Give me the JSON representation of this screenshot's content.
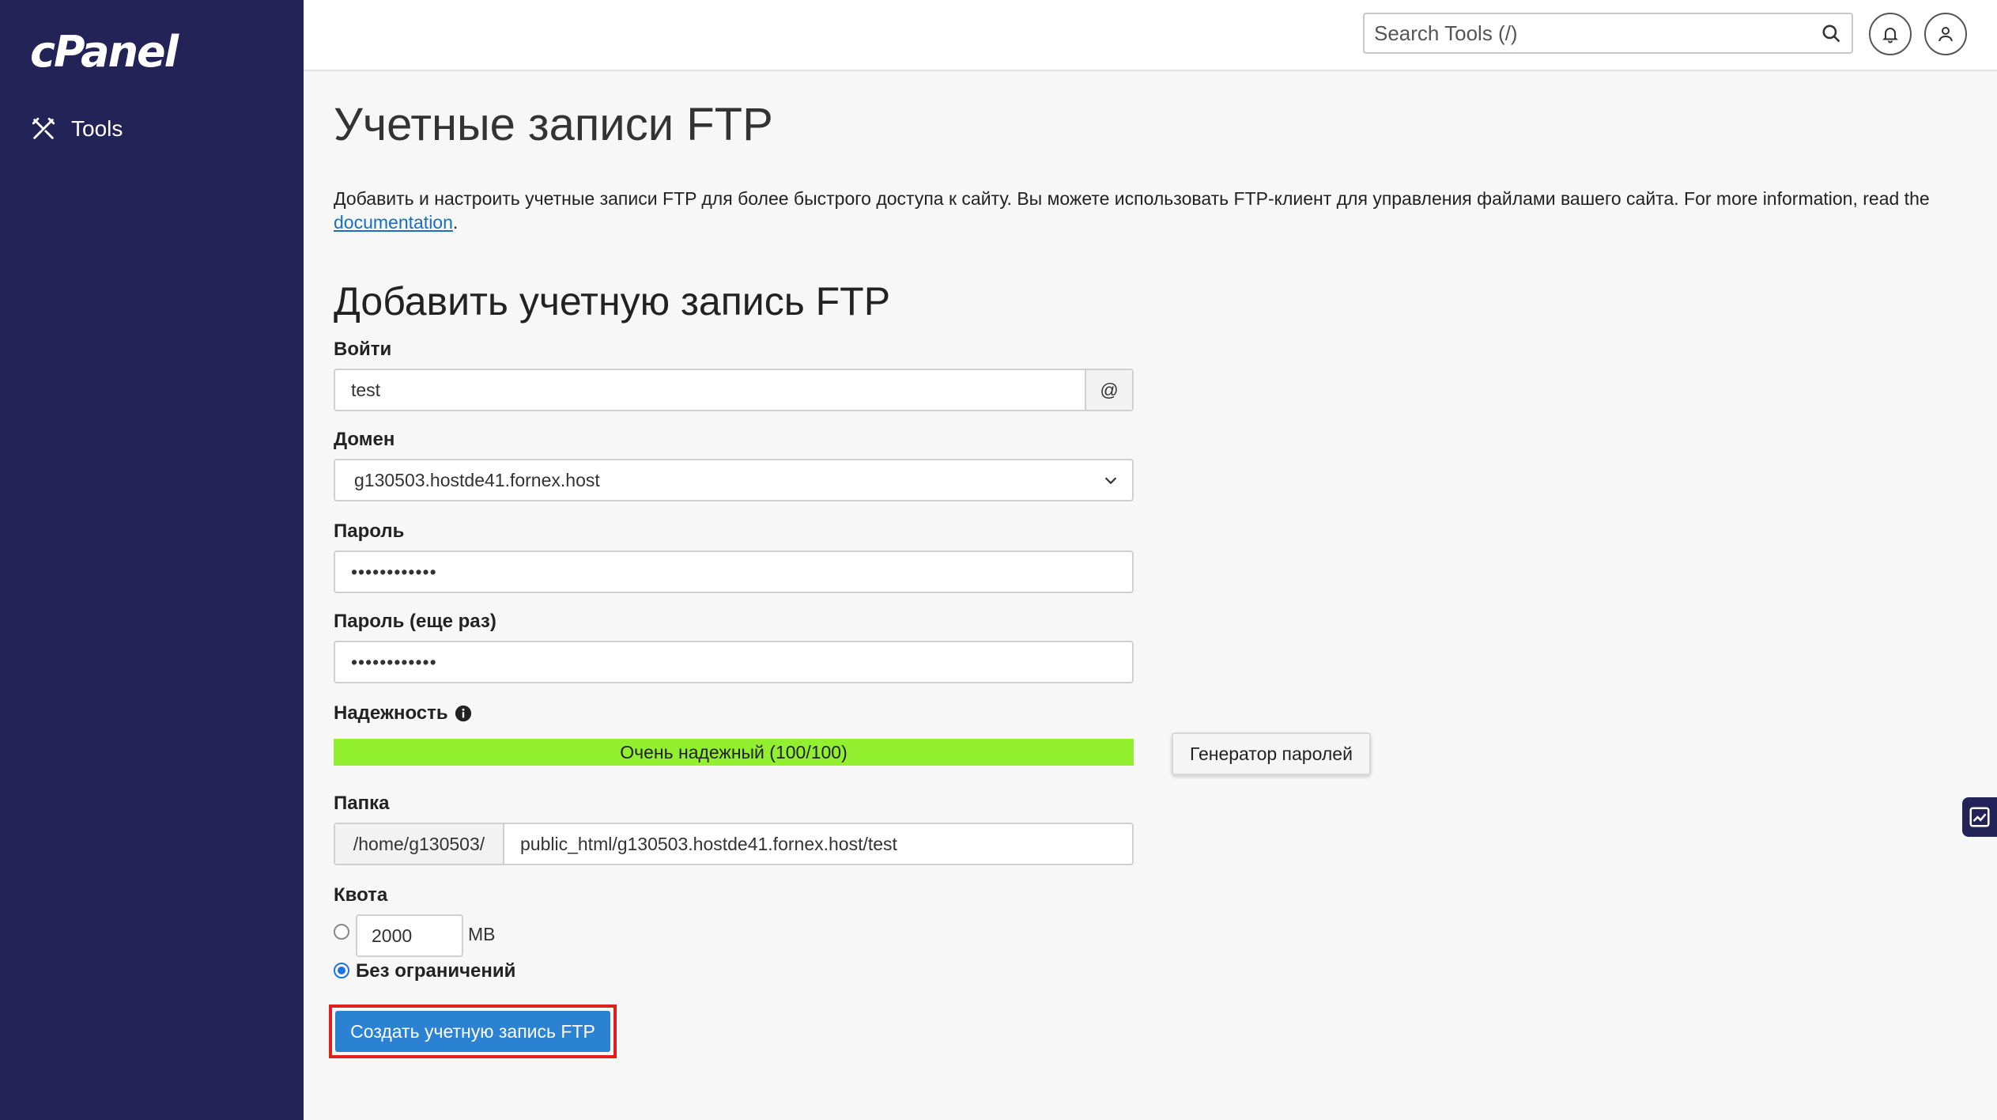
{
  "brand": {
    "logo_text": "cPanel"
  },
  "sidebar": {
    "items": [
      {
        "label": "Tools",
        "icon": "tools-icon"
      }
    ]
  },
  "header": {
    "search_placeholder": "Search Tools (/)",
    "icons": [
      "search-icon",
      "bell-icon",
      "user-icon"
    ]
  },
  "page": {
    "title": "Учетные записи FTP",
    "intro_text": "Добавить и настроить учетные записи FTP для более быстрого доступа к сайту. Вы можете использовать FTP-клиент для управления файлами вашего сайта. For more information, read the ",
    "intro_link": "documentation",
    "intro_end": "."
  },
  "form": {
    "section_title": "Добавить учетную запись FTP",
    "login_label": "Войти",
    "login_value": "test",
    "login_addon": "@",
    "domain_label": "Домен",
    "domain_value": "g130503.hostde41.fornex.host",
    "password_label": "Пароль",
    "password_value": "••••••••••••",
    "password2_label": "Пароль (еще раз)",
    "password2_value": "••••••••••••",
    "strength_label": "Надежность",
    "strength_text": "Очень надежный (100/100)",
    "strength_score": 100,
    "strength_color": "#93f031",
    "generator_button": "Генератор паролей",
    "folder_label": "Папка",
    "folder_prefix": "/home/g130503/",
    "folder_value": "public_html/g130503.hostde41.fornex.host/test",
    "quota_label": "Квота",
    "quota_value": "2000",
    "quota_unit": "MB",
    "quota_unlimited_label": "Без ограничений",
    "quota_selected": "unlimited",
    "submit_button": "Создать учетную запись FTP"
  },
  "colors": {
    "sidebar_bg": "#232357",
    "primary_button": "#2b82d3",
    "highlight_border": "#e0201c"
  }
}
